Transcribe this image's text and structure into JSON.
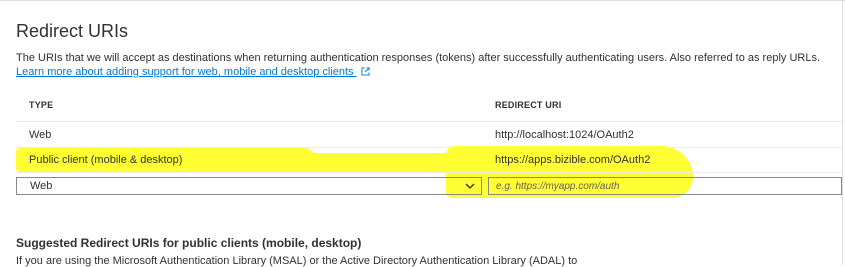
{
  "section": {
    "title": "Redirect URIs",
    "description": "The URIs that we will accept as destinations when returning authentication responses (tokens) after successfully authenticating users. Also referred to as reply URLs.",
    "learn_more_link": "Learn more about adding support for web, mobile and desktop clients"
  },
  "table": {
    "headers": {
      "type": "TYPE",
      "redirect_uri": "REDIRECT URI"
    },
    "rows": [
      {
        "type": "Web",
        "redirect_uri": "http://localhost:1024/OAuth2"
      },
      {
        "type": "Public client (mobile & desktop)",
        "redirect_uri": "https://apps.bizible.com/OAuth2"
      }
    ],
    "new_entry": {
      "type_selected": "Web",
      "uri_placeholder": "e.g. https://myapp.com/auth"
    }
  },
  "suggested": {
    "title": "Suggested Redirect URIs for public clients (mobile, desktop)",
    "body": "If you are using the Microsoft Authentication Library (MSAL) or the Active Directory Authentication Library (ADAL) to"
  },
  "colors": {
    "highlight": "#ffff33",
    "link": "#0078d4",
    "text": "#323130"
  },
  "icons": {
    "learn_more": "external-link-icon",
    "select": "chevron-down-icon"
  }
}
